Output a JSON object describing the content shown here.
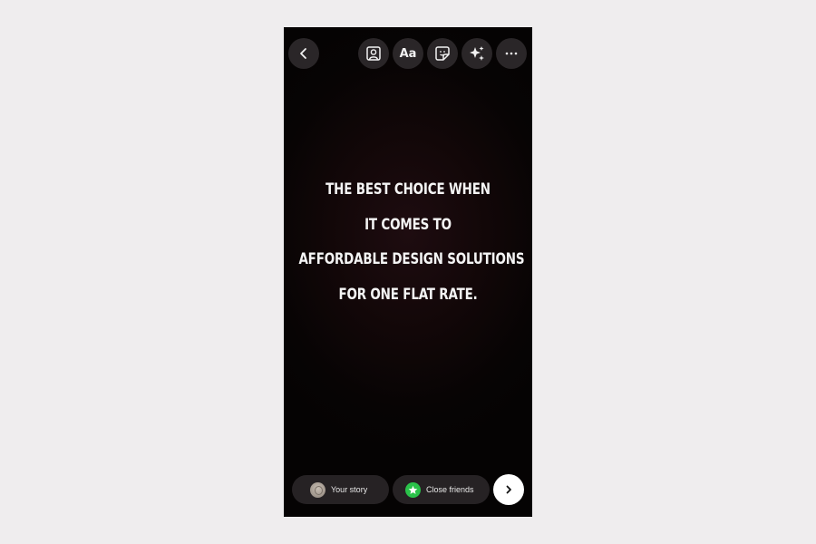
{
  "toolbar": {
    "back_icon": "chevron-left-icon",
    "tag_people_icon": "person-frame-icon",
    "text_tool_label": "Aa",
    "sticker_icon": "sticker-icon",
    "effects_icon": "sparkles-icon",
    "more_icon": "more-horizontal-icon"
  },
  "story": {
    "lines": [
      "THE BEST CHOICE WHEN",
      "IT COMES TO",
      "AFFORDABLE DESIGN SOLUTIONS",
      "FOR ONE FLAT RATE."
    ],
    "background_color": "#0b0606",
    "text_color": "#f4f4f4"
  },
  "bottom": {
    "your_story_label": "Your story",
    "close_friends_label": "Close friends",
    "close_friends_color": "#2ac24a",
    "next_icon": "chevron-right-icon"
  }
}
